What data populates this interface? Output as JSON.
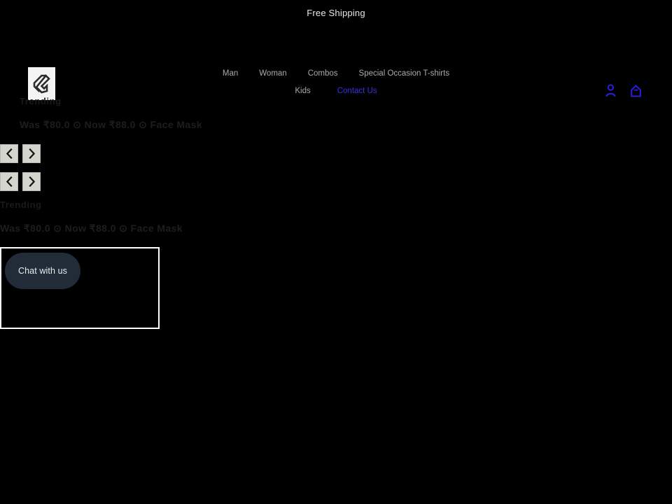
{
  "announcement": {
    "text": "Free Shipping"
  },
  "header": {
    "logo_name": "store-logo",
    "nav_row_one": [
      {
        "label": "Man",
        "visited": false
      },
      {
        "label": "Woman",
        "visited": false
      },
      {
        "label": "Combos",
        "visited": false
      },
      {
        "label": "Special Occasion T-shirts",
        "visited": false
      }
    ],
    "nav_row_two": [
      {
        "label": "Kids",
        "visited": false
      },
      {
        "label": "Contact Us",
        "visited": true
      }
    ],
    "icons": [
      {
        "name": "account-icon",
        "label": "Account"
      },
      {
        "name": "cart-icon",
        "label": "Cart"
      }
    ]
  },
  "sections": {
    "trending_top": {
      "title": "Trending",
      "price_line": "Was ₹80.0 ⊙ Now ₹88.0 ⊙ Face Mask"
    },
    "trending_bottom": {
      "title": "Trending",
      "price_line": "Was ₹80.0 ⊙ Now ₹88.0 ⊙ Face Mask"
    }
  },
  "carousel": {
    "rows": [
      {
        "prev_label": "‹",
        "next_label": "›"
      },
      {
        "prev_label": "‹",
        "next_label": "›"
      }
    ]
  },
  "chat": {
    "button_label": "Chat with us"
  },
  "colors": {
    "background": "#000000",
    "accent_link": "#3a2fe8",
    "icon_blue": "#2a1ee0",
    "carousel_button": "#d5d5d0",
    "chat_pill": "#222b38"
  }
}
